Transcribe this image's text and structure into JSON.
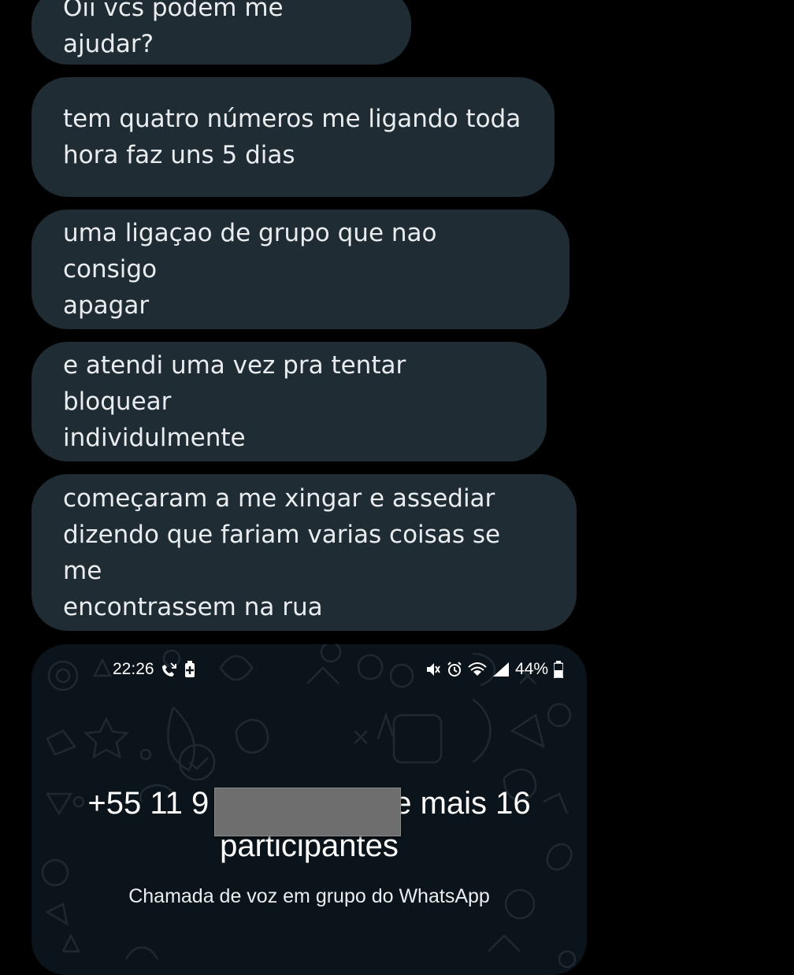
{
  "messages": [
    {
      "text": "Oii vcs podem me ajudar?"
    },
    {
      "text": "tem quatro números me ligando toda\nhora faz uns 5 dias"
    },
    {
      "text": "uma ligaçao de grupo que nao consigo\napagar"
    },
    {
      "text": "e atendi uma vez pra tentar bloquear\nindividulmente"
    },
    {
      "text": "começaram a me xingar e assediar\ndizendo que fariam varias coisas se me\nencontrassem na rua"
    }
  ],
  "colors": {
    "background": "#000000",
    "bubble": "#202C33",
    "bubble_text": "#E9EDEF",
    "call_screen": "#0B141A"
  },
  "call_screenshot": {
    "status_bar": {
      "time": "22:26",
      "battery": "44%",
      "left_icons": [
        "missed-call-icon",
        "battery-saver-icon"
      ],
      "right_icons": [
        "mute-vibrate-icon",
        "alarm-icon",
        "wifi-icon",
        "signal-icon",
        "battery-icon"
      ]
    },
    "caller_prefix": "+55 11 9",
    "caller_suffix": "e mais 16",
    "caller_line2": "participantes",
    "subtitle": "Chamada de voz em grupo do WhatsApp"
  }
}
